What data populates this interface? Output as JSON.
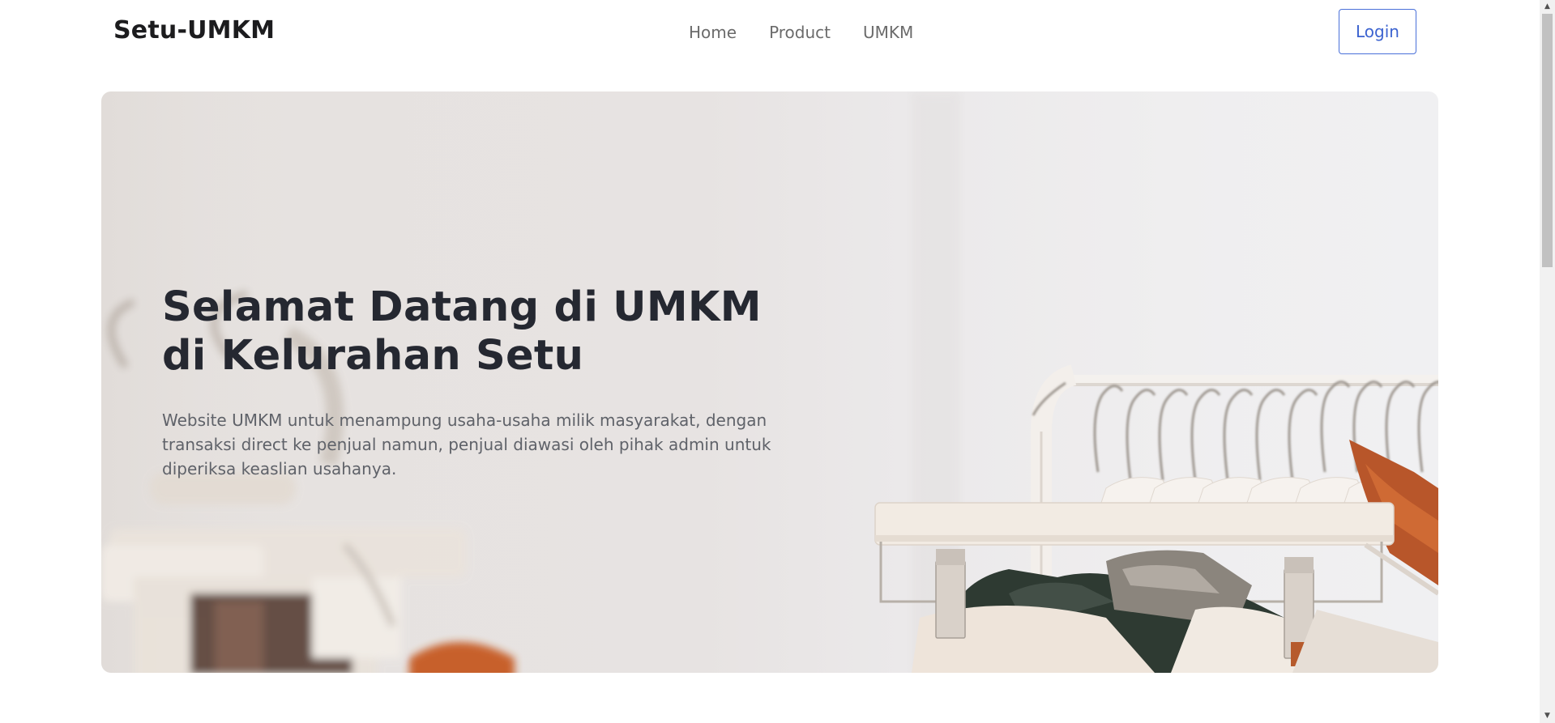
{
  "navbar": {
    "brand": "Setu-UMKM",
    "links": [
      "Home",
      "Product",
      "UMKM"
    ],
    "login_label": "Login"
  },
  "hero": {
    "title_line1": "Selamat Datang di UMKM",
    "title_line2": "di Kelurahan Setu",
    "description": "Website UMKM untuk menampung usaha-usaha milik masyarakat, dengan transaksi direct ke penjual namun, penjual diawasi oleh pihak admin untuk diperiksa keaslian usahanya."
  },
  "colors": {
    "accent": "#3c63d0",
    "title_text": "#252831",
    "body_text": "#5f6269"
  }
}
